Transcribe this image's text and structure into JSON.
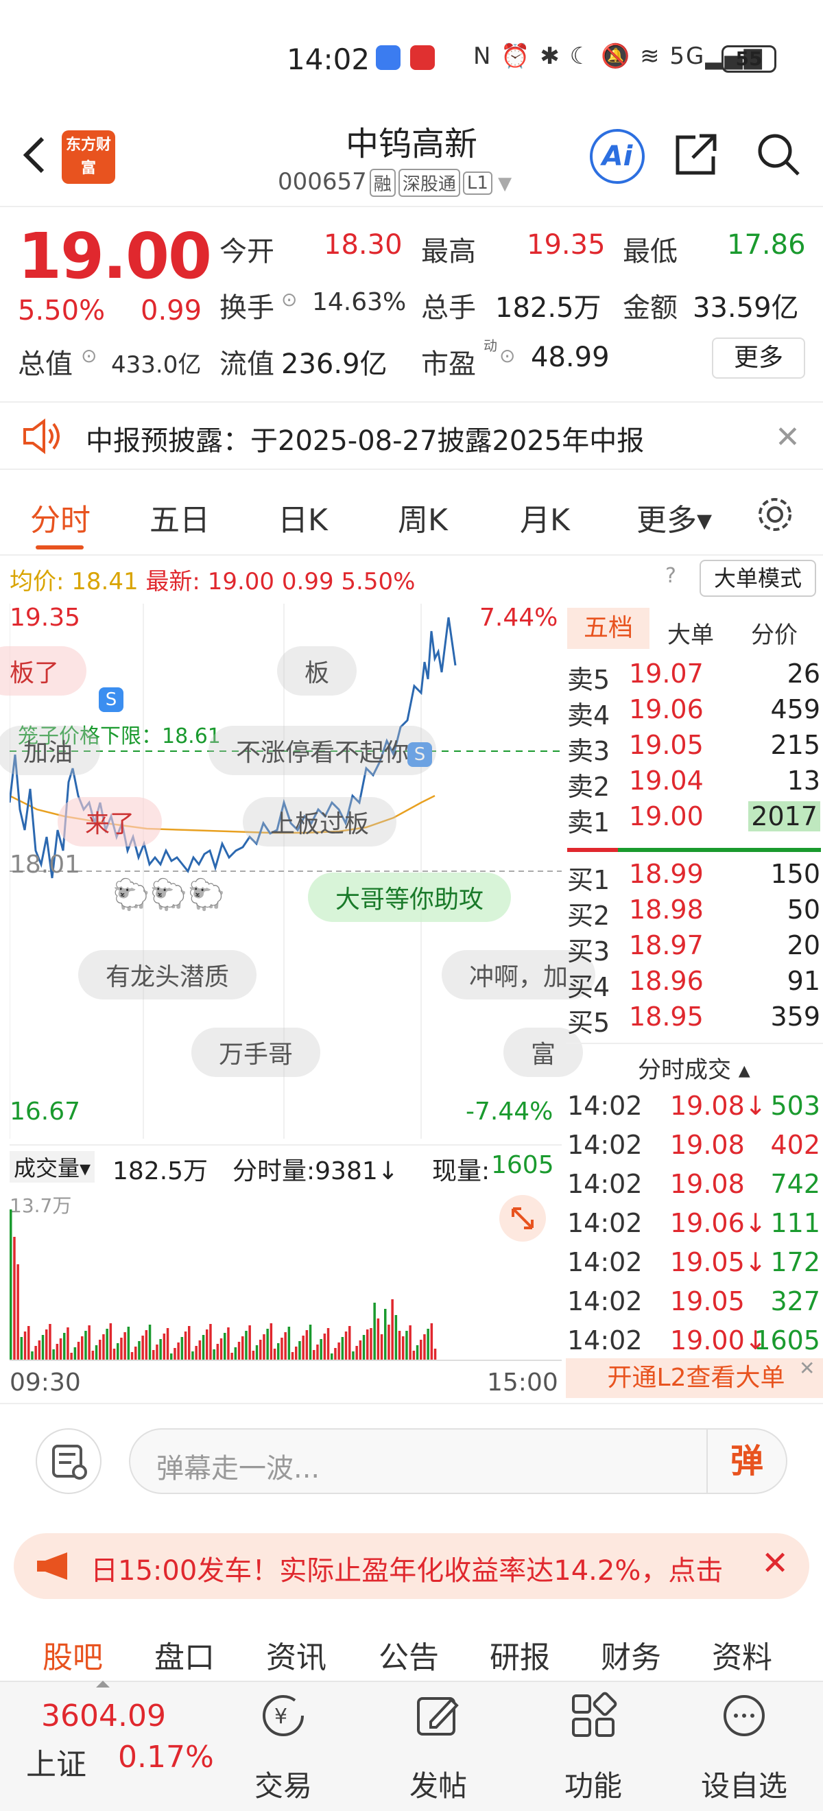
{
  "status_bar": {
    "time": "14:02",
    "indicators": "N ⏰ ✱ ☾ 🔕 ≋ 5G▂▄▆",
    "battery": "55"
  },
  "header": {
    "logo_text": "东方财富",
    "name": "中钨高新",
    "code": "000657",
    "tags": [
      "融",
      "深股通",
      "L1"
    ]
  },
  "quote": {
    "price": "19.00",
    "change_pct": "5.50%",
    "change": "0.99",
    "open_label": "今开",
    "open": "18.30",
    "high_label": "最高",
    "high": "19.35",
    "low_label": "最低",
    "low": "17.86",
    "turnover_label": "换手",
    "turnover": "14.63%",
    "volume_label": "总手",
    "volume": "182.5万",
    "amount_label": "金额",
    "amount": "33.59亿",
    "mktcap_label": "总值",
    "mktcap": "433.0亿",
    "float_label": "流值",
    "float": "236.9亿",
    "pe_label": "市盈",
    "pe_sup": "动",
    "pe": "48.99",
    "more": "更多"
  },
  "notice": {
    "text": "中报预披露：于2025-08-27披露2025年中报"
  },
  "tabs": [
    "分时",
    "五日",
    "日K",
    "周K",
    "月K",
    "更多▾"
  ],
  "info_line": {
    "avg_label": "均价:",
    "avg": "18.41",
    "latest_label": "最新:",
    "latest": "19.00",
    "change": "0.99",
    "pct": "5.50%",
    "bigorder_btn": "大单模式"
  },
  "chart": {
    "high": "19.35",
    "high_pct": "7.44%",
    "low": "16.67",
    "low_pct": "-7.44%",
    "ref": "18.01",
    "cage_label": "笼子价格下限：18.61",
    "time_start": "09:30",
    "time_end": "15:00",
    "vol_max": "13.7万"
  },
  "danmu": [
    "板了",
    "板",
    "加油",
    "不涨停看不起你",
    "来了",
    "上板过板",
    "大哥等你助攻",
    "有龙头潜质",
    "冲啊，加",
    "万手哥",
    "富"
  ],
  "volume_bar": {
    "label": "成交量▾",
    "total": "182.5万",
    "tick_label": "分时量:9381↓",
    "now_label": "现量:",
    "now": "1605"
  },
  "orderbook": {
    "tabs": [
      "五档",
      "大单",
      "分价"
    ],
    "asks": [
      [
        "卖5",
        "19.07",
        "26"
      ],
      [
        "卖4",
        "19.06",
        "459"
      ],
      [
        "卖3",
        "19.05",
        "215"
      ],
      [
        "卖2",
        "19.04",
        "13"
      ],
      [
        "卖1",
        "19.00",
        "2017"
      ]
    ],
    "bids": [
      [
        "买1",
        "18.99",
        "150"
      ],
      [
        "买2",
        "18.98",
        "50"
      ],
      [
        "买3",
        "18.97",
        "20"
      ],
      [
        "买4",
        "18.96",
        "91"
      ],
      [
        "买5",
        "18.95",
        "359"
      ]
    ],
    "trades_title": "分时成交 ▴",
    "trades": [
      [
        "14:02",
        "19.08↓",
        "503"
      ],
      [
        "14:02",
        "19.08",
        "402"
      ],
      [
        "14:02",
        "19.08",
        "742"
      ],
      [
        "14:02",
        "19.06↓",
        "111"
      ],
      [
        "14:02",
        "19.05↓",
        "172"
      ],
      [
        "14:02",
        "19.05",
        "327"
      ],
      [
        "14:02",
        "19.00↓",
        "1605"
      ]
    ],
    "l2_banner": "开通L2查看大单"
  },
  "comment": {
    "placeholder": "弹幕走一波...",
    "danmu_btn": "弹"
  },
  "ad": {
    "text": "日15:00发车！实际止盈年化收益率达14.2%，点击"
  },
  "bottom_tabs": [
    "股吧",
    "盘口",
    "资讯",
    "公告",
    "研报",
    "财务",
    "资料"
  ],
  "nav": {
    "index_value": "3604.09",
    "index_name": "上证",
    "index_pct": "0.17%",
    "items": [
      "交易",
      "发帖",
      "功能",
      "设自选"
    ]
  },
  "colors": {
    "up": "#e0282e",
    "down": "#1a9a2e",
    "accent": "#e8531f"
  }
}
